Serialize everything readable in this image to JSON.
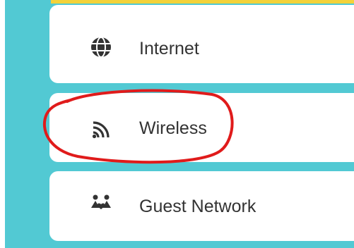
{
  "menu": {
    "items": [
      {
        "label": "Internet",
        "icon": "globe-icon"
      },
      {
        "label": "Wireless",
        "icon": "wifi-icon"
      },
      {
        "label": "Guest Network",
        "icon": "guest-network-icon"
      }
    ]
  },
  "colors": {
    "background": "#52c9d3",
    "item_background": "#ffffff",
    "top_accent": "#f3d23a",
    "annotation": "#e01b1b",
    "icon": "#333333"
  }
}
